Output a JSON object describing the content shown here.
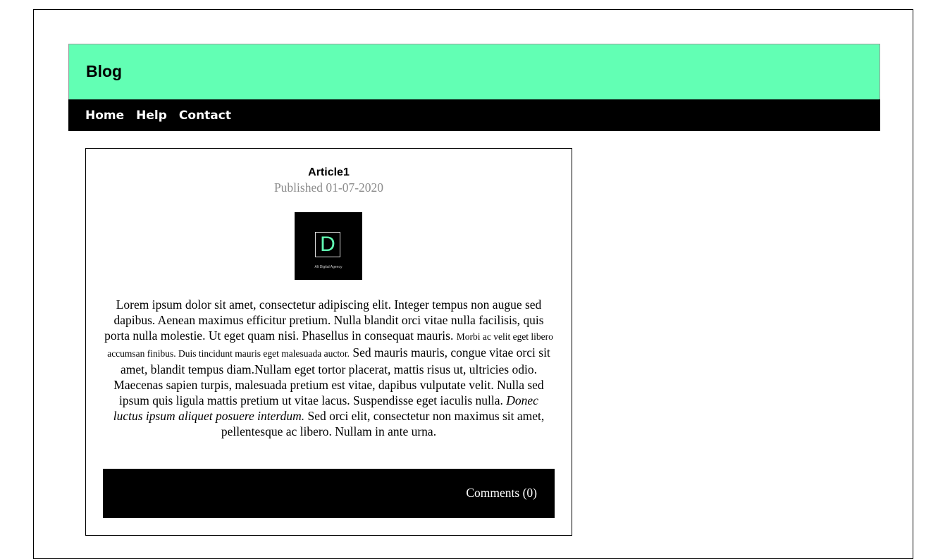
{
  "header": {
    "title": "Blog"
  },
  "nav": {
    "items": [
      {
        "label": "Home"
      },
      {
        "label": "Help"
      },
      {
        "label": "Contact"
      }
    ]
  },
  "article": {
    "title": "Article1",
    "published": "Published 01-07-2020",
    "logo": {
      "letter": "D",
      "caption": "Alt Digital Agency",
      "icon": "d-logo-icon",
      "accent_color": "#62ffb4"
    },
    "body": {
      "part1": "Lorem ipsum dolor sit amet, consectetur adipiscing elit. Integer tempus non augue sed dapibus. Aenean maximus efficitur pretium. Nulla blandit orci vitae nulla facilisis, quis porta nulla molestie. Ut eget quam nisi. Phasellus in consequat mauris. ",
      "small": "Morbi ac velit eget libero accumsan finibus. Duis tincidunt mauris eget malesuada auctor.",
      "part2": " Sed mauris mauris, congue vitae orci sit amet, blandit tempus diam.Nullam eget tortor placerat, mattis risus ut, ultricies odio. Maecenas sapien turpis, malesuada pretium est vitae, dapibus vulputate velit. Nulla sed ipsum quis ligula mattis pretium ut vitae lacus. Suspendisse eget iaculis nulla. ",
      "italic": "Donec luctus ipsum aliquet posuere interdum.",
      "part3": " Sed orci elit, consectetur non maximus sit amet, pellentesque ac libero. Nullam in ante urna."
    },
    "comments_label": "Comments (0)"
  },
  "colors": {
    "header_bg": "#62ffb4",
    "nav_bg": "#000000",
    "date_text": "#8c8c8c"
  }
}
